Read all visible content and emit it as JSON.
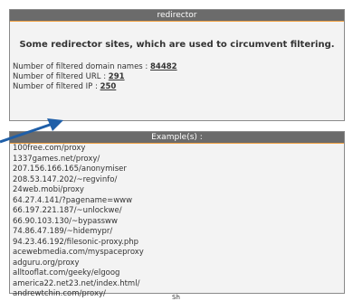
{
  "top": {
    "header": "redirector",
    "summary": "Some redirector sites, which are used to circumvent filtering.",
    "stats": [
      {
        "label": "Number of filtered domain names : ",
        "value": "84482"
      },
      {
        "label": "Number of filtered URL : ",
        "value": "291"
      },
      {
        "label": "Number of filtered IP : ",
        "value": "250"
      }
    ]
  },
  "examples": {
    "header": "Example(s) :",
    "items": [
      "100free.com/proxy",
      "1337games.net/proxy/",
      "207.156.166.165/anonymiser",
      "208.53.147.202/~regvinfo/",
      "24web.mobi/proxy",
      "64.27.4.141/?pagename=www",
      "66.197.221.187/~unlockwe/",
      "66.90.103.130/~bypassww",
      "74.86.47.189/~hidemypr/",
      "94.23.46.192/filesonic-proxy.php",
      "acewebmedia.com/myspaceproxy",
      "adguru.org/proxy",
      "alltooflat.com/geeky/elgoog",
      "america22.net23.net/index.html/",
      "andrewtchin.com/proxy/"
    ]
  },
  "footer_fragment": "Sh"
}
